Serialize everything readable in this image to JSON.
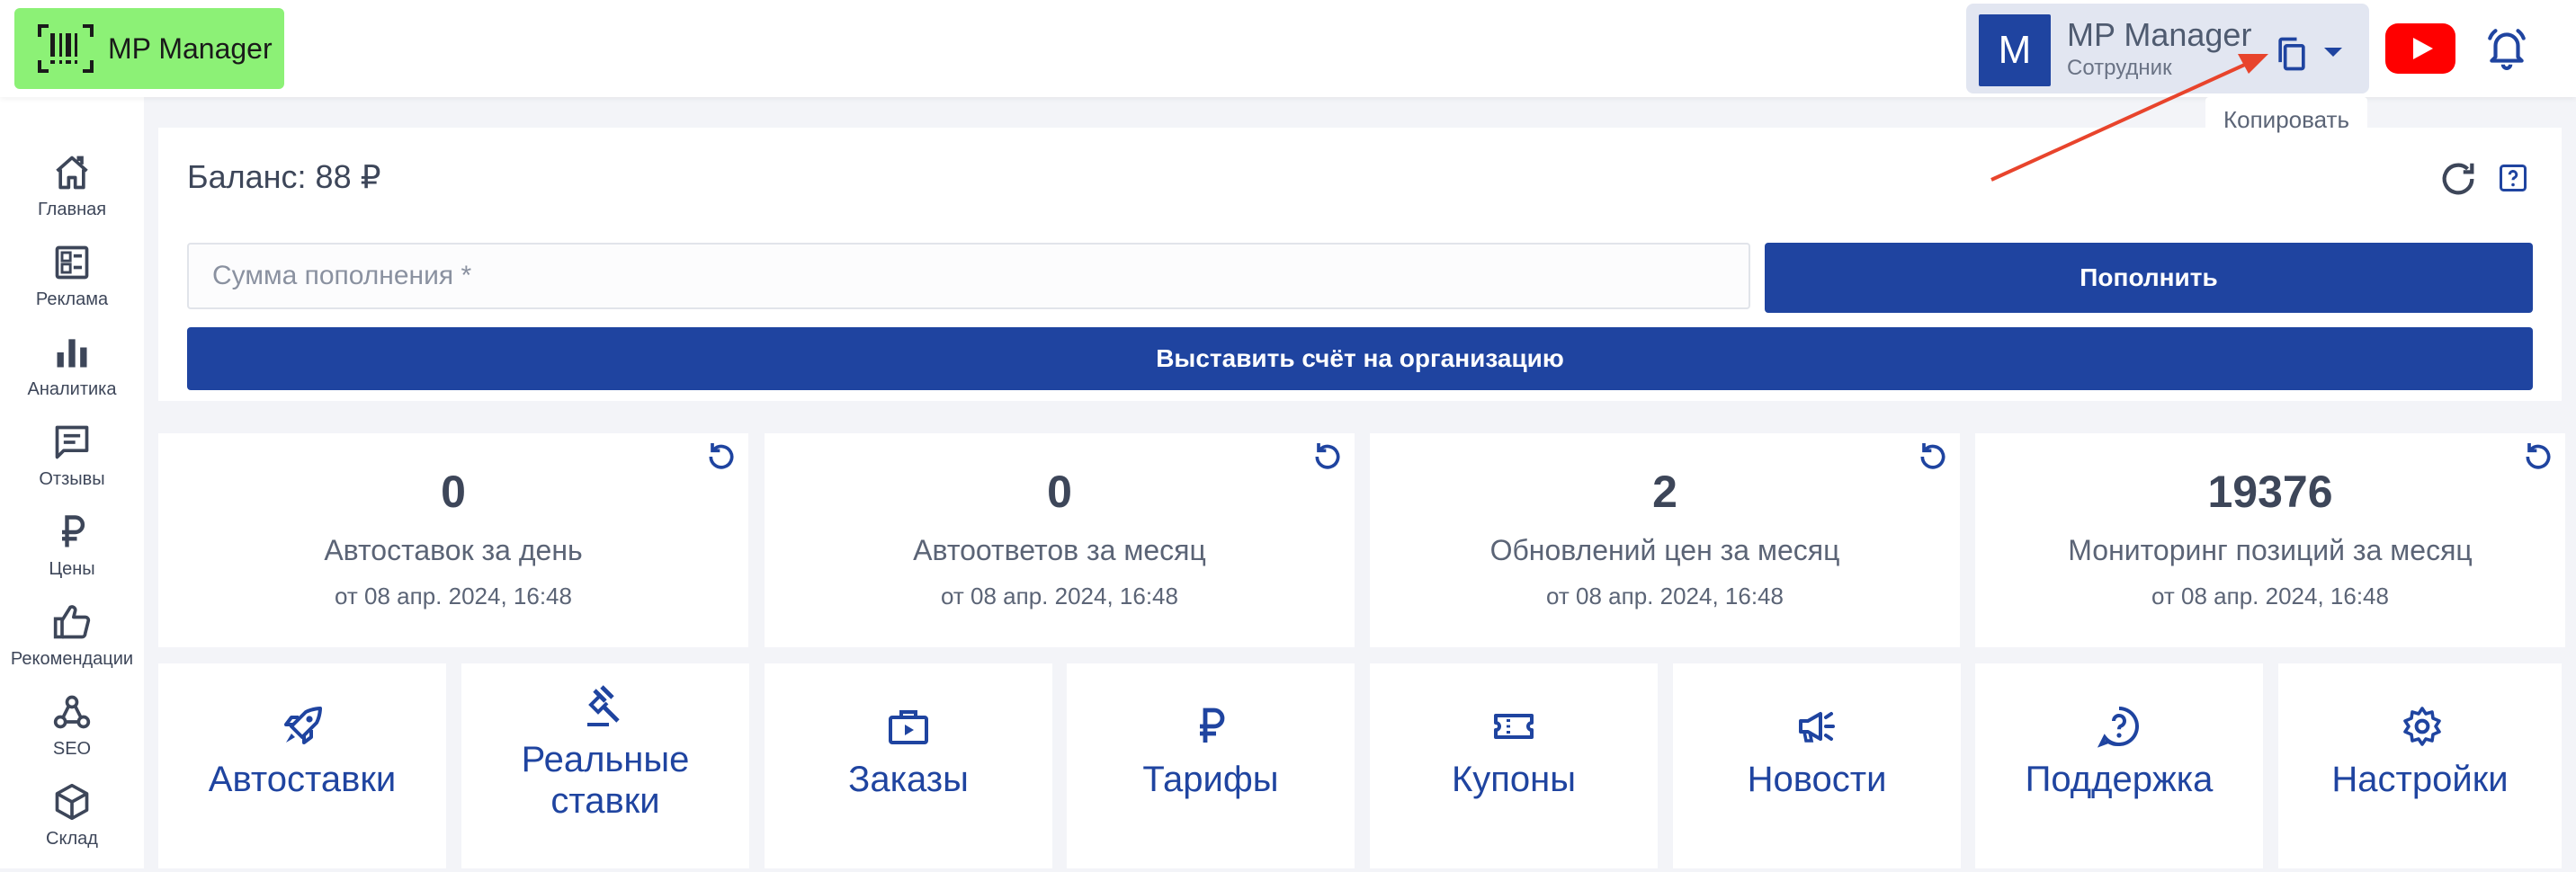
{
  "header": {
    "logo_text": "MP Manager",
    "user_initial": "M",
    "user_name": "MP Manager",
    "user_role": "Сотрудник",
    "copy_tooltip": "Копировать"
  },
  "sidebar": {
    "items": [
      {
        "label": "Главная",
        "icon": "home-icon"
      },
      {
        "label": "Реклама",
        "icon": "ads-icon"
      },
      {
        "label": "Аналитика",
        "icon": "bar-chart-icon"
      },
      {
        "label": "Отзывы",
        "icon": "message-icon"
      },
      {
        "label": "Цены",
        "icon": "ruble-icon"
      },
      {
        "label": "Рекомендации",
        "icon": "thumbs-up-icon"
      },
      {
        "label": "SEO",
        "icon": "webhook-icon"
      },
      {
        "label": "Склад",
        "icon": "box-icon"
      }
    ]
  },
  "balance": {
    "title": "Баланс: 88 ₽",
    "input_placeholder": "Сумма пополнения *",
    "topup_label": "Пополнить",
    "invoice_label": "Выставить счёт на организацию"
  },
  "stats": [
    {
      "value": "0",
      "label": "Автоставок за день",
      "date": "от 08 апр. 2024, 16:48"
    },
    {
      "value": "0",
      "label": "Автоответов за месяц",
      "date": "от 08 апр. 2024, 16:48"
    },
    {
      "value": "2",
      "label": "Обновлений цен за месяц",
      "date": "от 08 апр. 2024, 16:48"
    },
    {
      "value": "19376",
      "label": "Мониторинг позиций за месяц",
      "date": "от 08 апр. 2024, 16:48"
    }
  ],
  "tiles": [
    {
      "label_line1": "Автоставки",
      "label_line2": "",
      "icon": "rocket-icon"
    },
    {
      "label_line1": "Реальные",
      "label_line2": "ставки",
      "icon": "gavel-icon"
    },
    {
      "label_line1": "Заказы",
      "label_line2": "",
      "icon": "orders-icon"
    },
    {
      "label_line1": "Тарифы",
      "label_line2": "",
      "icon": "ruble-icon"
    },
    {
      "label_line1": "Купоны",
      "label_line2": "",
      "icon": "coupon-icon"
    },
    {
      "label_line1": "Новости",
      "label_line2": "",
      "icon": "megaphone-icon"
    },
    {
      "label_line1": "Поддержка",
      "label_line2": "",
      "icon": "help-circle-icon"
    },
    {
      "label_line1": "Настройки",
      "label_line2": "",
      "icon": "gear-icon"
    }
  ],
  "colors": {
    "primary": "#1f44a0",
    "logo_bg": "#8cf176",
    "annotation_arrow": "#e8442c"
  }
}
